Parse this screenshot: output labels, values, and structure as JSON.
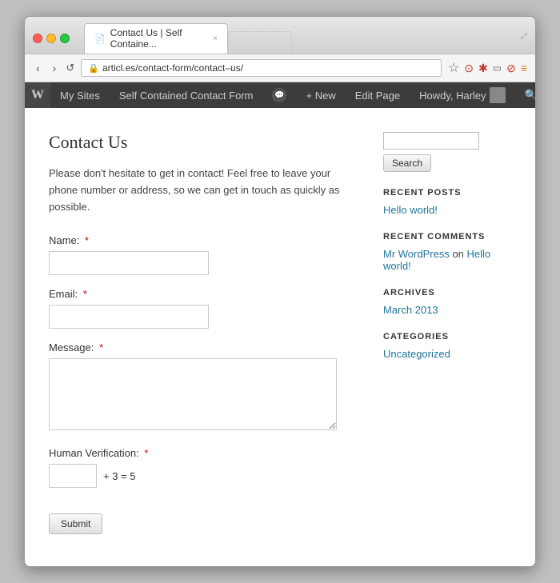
{
  "browser": {
    "tab_title": "Contact Us | Self Containe...",
    "tab_close": "×",
    "back_btn": "‹",
    "forward_btn": "›",
    "refresh_btn": "↺",
    "address": "articl.es/contact-form/contact–us/",
    "star_icon": "☆",
    "clock_icon": "⊙",
    "plugin_icon": "✱",
    "window_icon": "▭",
    "stop_icon": "⊘",
    "extensions_icon": "≡"
  },
  "admin_bar": {
    "wp_icon": "W",
    "my_sites": "My Sites",
    "site_name": "Self Contained Contact Form",
    "comments_icon": "💬",
    "new_item": "+ New",
    "edit_page": "Edit Page",
    "howdy": "Howdy, Harley",
    "search_icon": "🔍"
  },
  "main": {
    "page_title": "Contact Us",
    "description": "Please don't hesitate to get in contact! Feel free to leave your phone number or address, so we can get in touch as quickly as possible.",
    "form": {
      "name_label": "Name:",
      "name_required": "*",
      "email_label": "Email:",
      "email_required": "*",
      "message_label": "Message:",
      "message_required": "*",
      "verification_label": "Human Verification:",
      "verification_required": "*",
      "verification_equation": "+ 3 = 5",
      "submit_label": "Submit"
    }
  },
  "sidebar": {
    "search_placeholder": "",
    "search_button": "Search",
    "recent_posts_title": "RECENT POSTS",
    "recent_posts": [
      {
        "title": "Hello world!",
        "url": "#"
      }
    ],
    "recent_comments_title": "RECENT COMMENTS",
    "recent_comments": [
      {
        "author": "Mr WordPress",
        "text": " on ",
        "link": "Hello world!"
      }
    ],
    "archives_title": "ARCHIVES",
    "archives": [
      {
        "title": "March 2013",
        "url": "#"
      }
    ],
    "categories_title": "CATEGORIES",
    "categories": [
      {
        "title": "Uncategorized",
        "url": "#"
      }
    ]
  },
  "traffic_lights": {
    "close": "#ff5f57",
    "minimize": "#febc2e",
    "maximize": "#28c840"
  }
}
